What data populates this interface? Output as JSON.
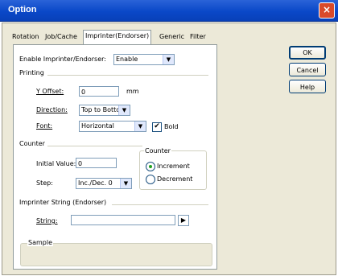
{
  "window": {
    "title": "Option",
    "close": "×"
  },
  "tabs": [
    "Rotation",
    "Job/Cache",
    "Imprinter(Endorser)",
    "Generic",
    "Filter"
  ],
  "enable": {
    "label": "Enable Imprinter/Endorser:",
    "value": "Enable"
  },
  "printing": {
    "group": "Printing",
    "y_offset_label": "Y Offset:",
    "y_offset_value": "0",
    "unit": "mm",
    "direction_label": "Direction:",
    "direction_value": "Top to Bottom",
    "font_label": "Font:",
    "font_value": "Horizontal",
    "bold_label": "Bold",
    "bold_checked": true
  },
  "counter": {
    "group": "Counter",
    "initial_label": "Initial Value:",
    "initial_value": "0",
    "step_label": "Step:",
    "step_value": "Inc./Dec. 0",
    "radio_group": "Counter",
    "increment": "Increment",
    "decrement": "Decrement",
    "selected": "Increment"
  },
  "string": {
    "group": "Imprinter String (Endorser)",
    "label": "String:",
    "value": ""
  },
  "sample": {
    "group": "Sample"
  },
  "buttons": {
    "ok": "OK",
    "cancel": "Cancel",
    "help": "Help"
  },
  "glyphs": {
    "dropdown": "▼",
    "play": "▶",
    "check": "✔"
  }
}
